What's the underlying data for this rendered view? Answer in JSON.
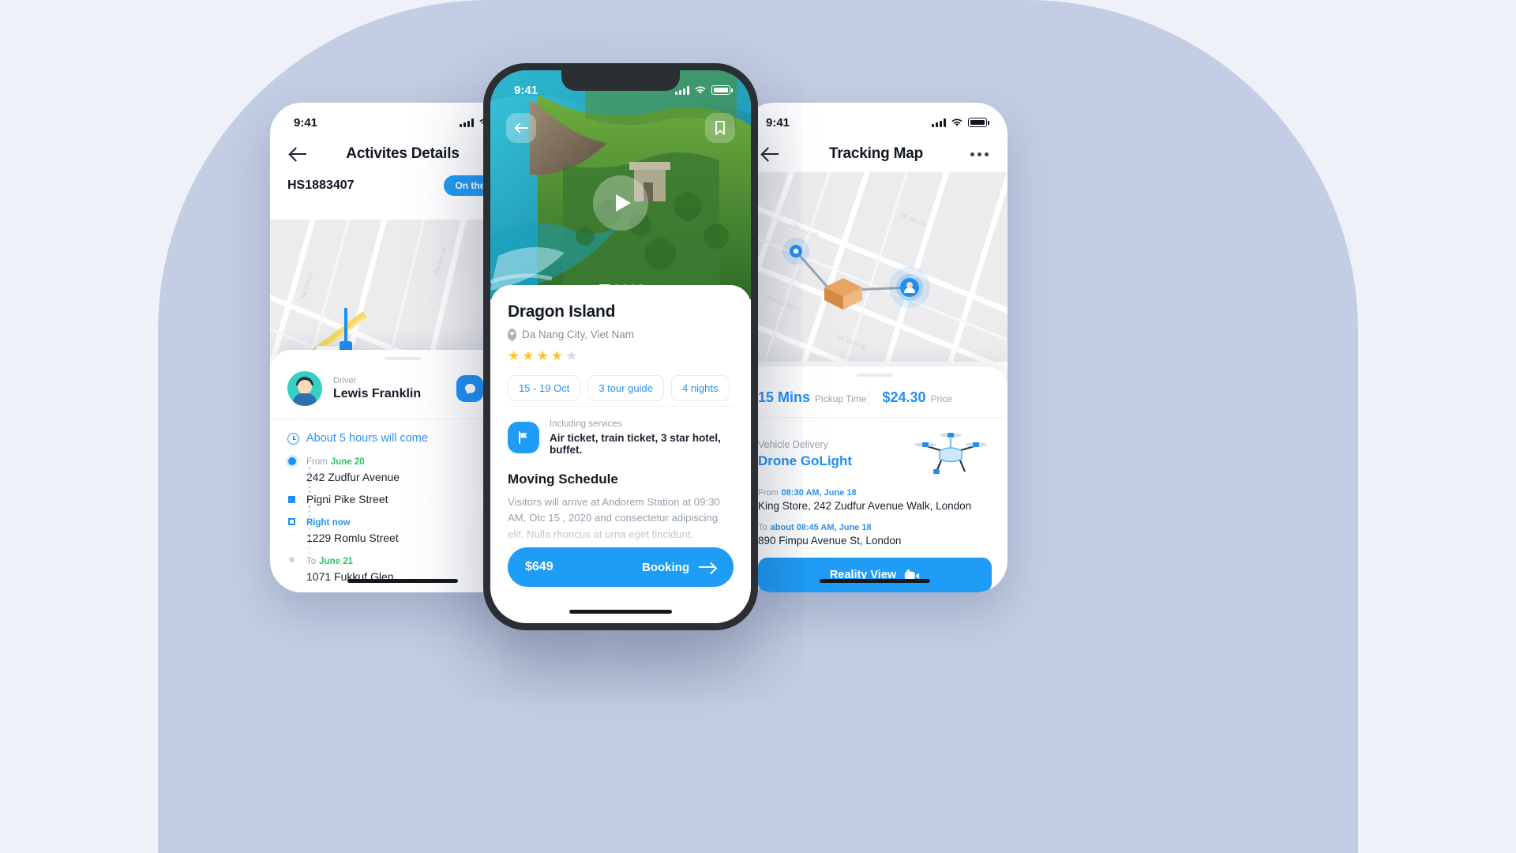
{
  "left_phone": {
    "status_time": "9:41",
    "nav_title": "Activites Details",
    "shipment_code": "HS1883407",
    "status_pill": "On the Way",
    "driver_label": "Driver",
    "driver_name": "Lewis Franklin",
    "eta_text": "About 5 hours will come",
    "timeline": [
      {
        "head": "From",
        "date": "June 20",
        "address": "242 Zudfur Avenue"
      },
      {
        "head": "",
        "date": "",
        "address": "Pigni Pike Street"
      },
      {
        "head": "Right now",
        "date": "",
        "address": "1229 Romlu Street"
      },
      {
        "head": "To",
        "date": "June 21",
        "address": "1071 Fukkuf Glen"
      }
    ]
  },
  "center_phone": {
    "status_time": "9:41",
    "title": "Dragon Island",
    "location": "Da Nang City, Viet Nam",
    "rating": 4,
    "rating_max": 5,
    "chips": [
      "15 - 19 Oct",
      "3 tour guide",
      "4 nights"
    ],
    "services_label": "Including services",
    "services_value": "Air ticket, train ticket, 3 star hotel, buffet.",
    "schedule_heading": "Moving Schedule",
    "schedule_text": "Visitors will arrive at Andorem Station at 09:30 AM, Otc 15 , 2020 and consectetur adipiscing elit. Nulla rhoncus at urna eget tincidunt. Maecenas pharetra aliquet neque ut commodo. Nam a magna risus. Fusce",
    "price": "$649",
    "book_label": "Booking",
    "carousel_dots": 5,
    "carousel_active": 0
  },
  "right_phone": {
    "status_time": "9:41",
    "nav_title": "Tracking Map",
    "pickup_value": "15 Mins",
    "pickup_label": "Pickup Time",
    "price_value": "$24.30",
    "price_label": "Price",
    "vehicle_label": "Vehicle Delivery",
    "vehicle_name": "Drone GoLight",
    "from_label": "From",
    "from_time": "08:30 AM, June 18",
    "from_address": "King Store, 242 Zudfur Avenue Walk, London",
    "to_label": "To",
    "to_time": "about 08:45 AM, June 18",
    "to_address": "890 Fimpu Avenue St, London",
    "cta_label": "Reality View"
  },
  "colors": {
    "accent": "#1f9cf5",
    "green": "#28c665",
    "star": "#ffc32b",
    "backdrop": "#c3cde3",
    "page_bg": "#eef1f8"
  }
}
